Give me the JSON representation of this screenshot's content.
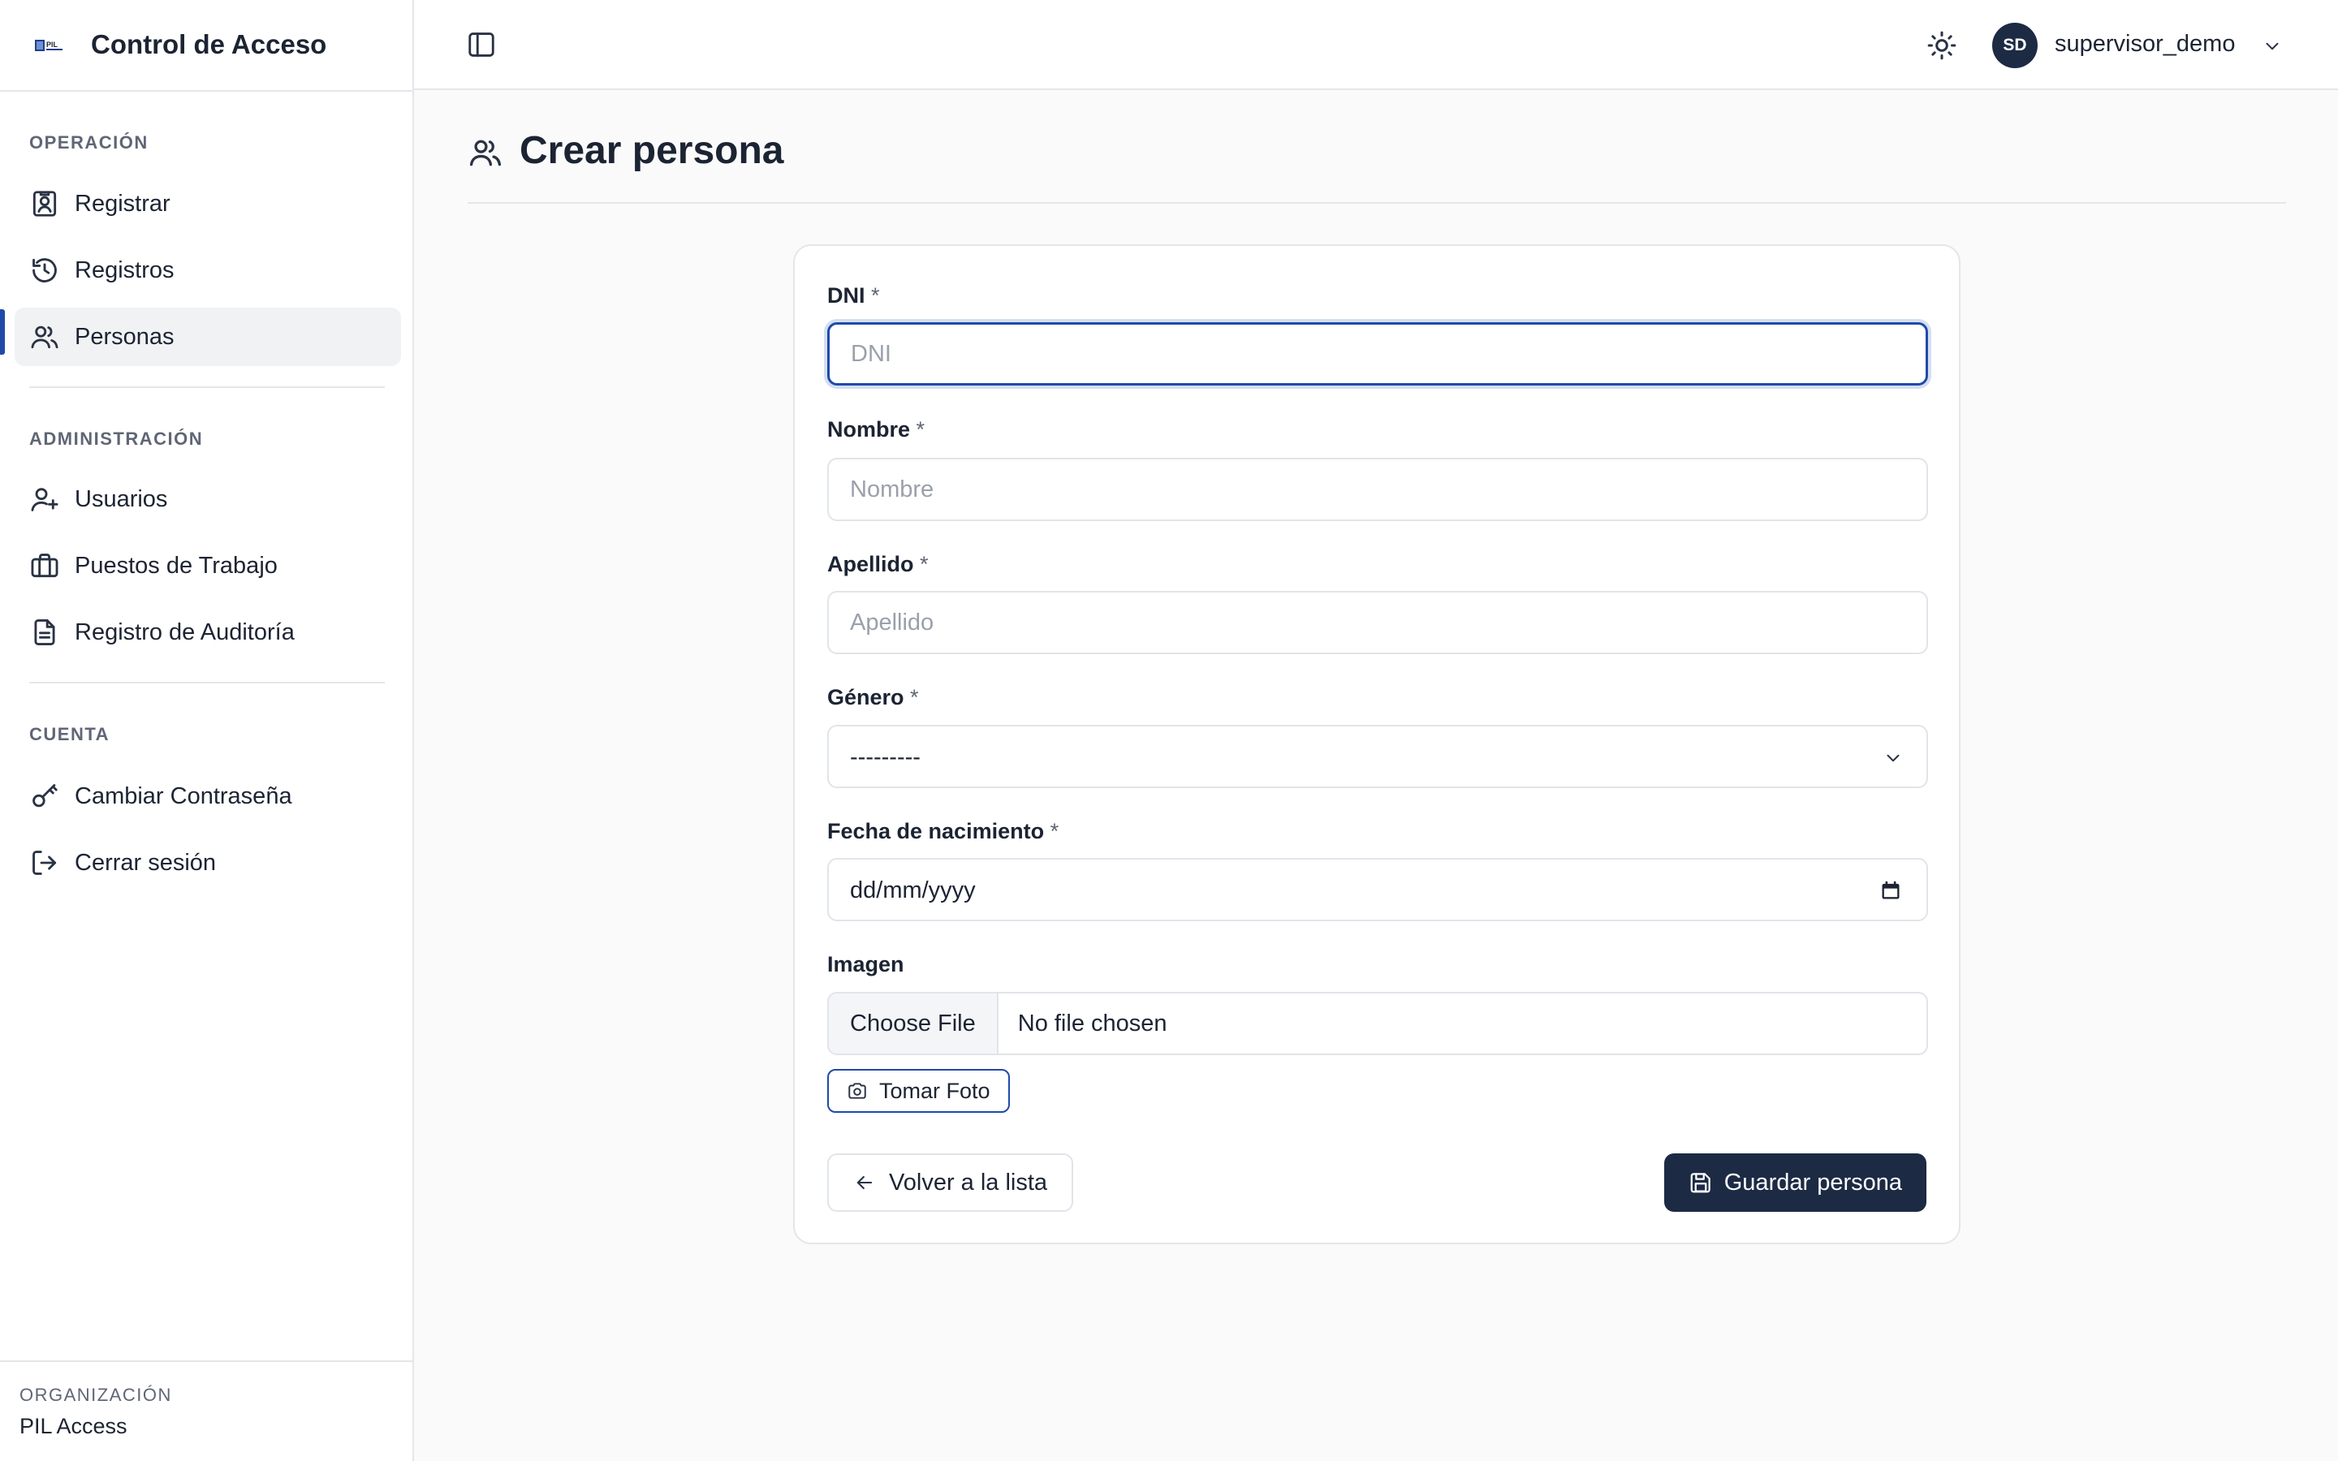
{
  "app": {
    "title": "Control de Acceso",
    "logo_text": "PIL"
  },
  "sidebar": {
    "sections": [
      {
        "label": "OPERACIÓN",
        "items": [
          {
            "label": "Registrar",
            "icon": "id-card-icon"
          },
          {
            "label": "Registros",
            "icon": "history-icon"
          },
          {
            "label": "Personas",
            "icon": "users-icon",
            "active": true
          }
        ]
      },
      {
        "label": "ADMINISTRACIÓN",
        "items": [
          {
            "label": "Usuarios",
            "icon": "user-plus-icon"
          },
          {
            "label": "Puestos de Trabajo",
            "icon": "briefcase-icon"
          },
          {
            "label": "Registro de Auditoría",
            "icon": "document-icon"
          }
        ]
      },
      {
        "label": "CUENTA",
        "items": [
          {
            "label": "Cambiar Contraseña",
            "icon": "key-icon"
          },
          {
            "label": "Cerrar sesión",
            "icon": "logout-icon"
          }
        ]
      }
    ],
    "org": {
      "label": "ORGANIZACIÓN",
      "name": "PIL Access"
    }
  },
  "topbar": {
    "user": {
      "initials": "SD",
      "name": "supervisor_demo"
    }
  },
  "page": {
    "title": "Crear persona"
  },
  "form": {
    "required_marker": "*",
    "dni": {
      "label": "DNI",
      "placeholder": "DNI",
      "value": ""
    },
    "nombre": {
      "label": "Nombre",
      "placeholder": "Nombre",
      "value": ""
    },
    "apellido": {
      "label": "Apellido",
      "placeholder": "Apellido",
      "value": ""
    },
    "genero": {
      "label": "Género",
      "selected": "---------"
    },
    "fecha": {
      "label": "Fecha de nacimiento",
      "value": "dd/mm/yyyy"
    },
    "imagen": {
      "label": "Imagen",
      "button": "Choose File",
      "status": "No file chosen"
    },
    "photo_button": "Tomar Foto",
    "back_button": "Volver a la lista",
    "save_button": "Guardar persona"
  },
  "colors": {
    "accent": "#1f4aa8",
    "primary_dark": "#1c2a44"
  }
}
